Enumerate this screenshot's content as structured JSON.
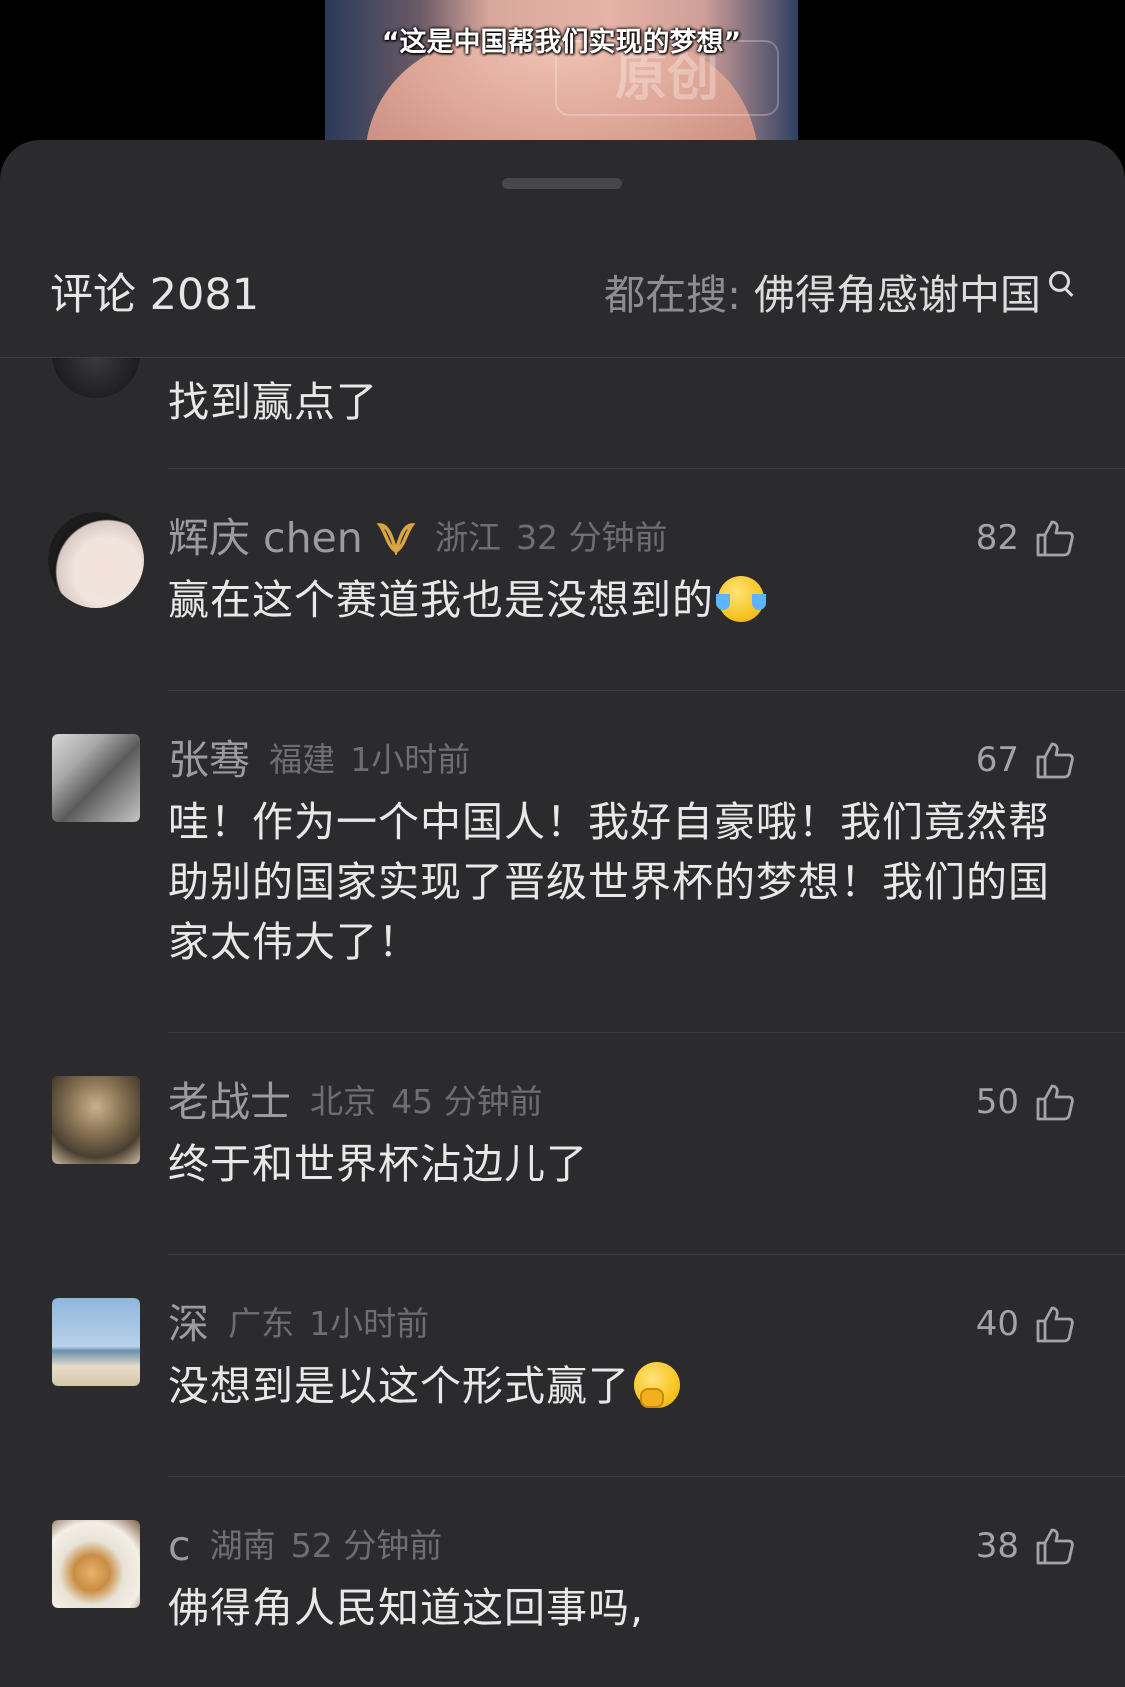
{
  "video": {
    "caption": "“这是中国帮我们实现的梦想”",
    "watermark": "原创"
  },
  "header": {
    "comments_label": "评论 2081",
    "search_prefix": "都在搜: ",
    "search_term": "佛得角感谢中国"
  },
  "comments": [
    {
      "user": "",
      "text": "找到赢点了",
      "partial": true
    },
    {
      "user": "辉庆 chen",
      "badge": "vip-badge-icon",
      "location": "浙江",
      "time": "32 分钟前",
      "likes": "82",
      "text": "赢在这个赛道我也是没想到的",
      "emoji": "laughing-crying-emoji"
    },
    {
      "user": "张骞",
      "location": "福建",
      "time": "1小时前",
      "likes": "67",
      "text": "哇！作为一个中国人！我好自豪哦！我们竟然帮助别的国家实现了晋级世界杯的梦想！我们的国家太伟大了！"
    },
    {
      "user": "老战士",
      "location": "北京",
      "time": "45 分钟前",
      "likes": "50",
      "text": "终于和世界杯沾边儿了"
    },
    {
      "user": "深",
      "location": "广东",
      "time": "1小时前",
      "likes": "40",
      "text": "没想到是以这个形式赢了",
      "emoji": "thinking-emoji"
    },
    {
      "user": "c",
      "location": "湖南",
      "time": "52 分钟前",
      "likes": "38",
      "text": "佛得角人民知道这回事吗,"
    }
  ],
  "colors": {
    "sheet_background": "#2b2b2d",
    "primary_text": "#e8e8e8",
    "secondary_text": "#9c9ca0",
    "badge_gold": "#d9a441"
  }
}
